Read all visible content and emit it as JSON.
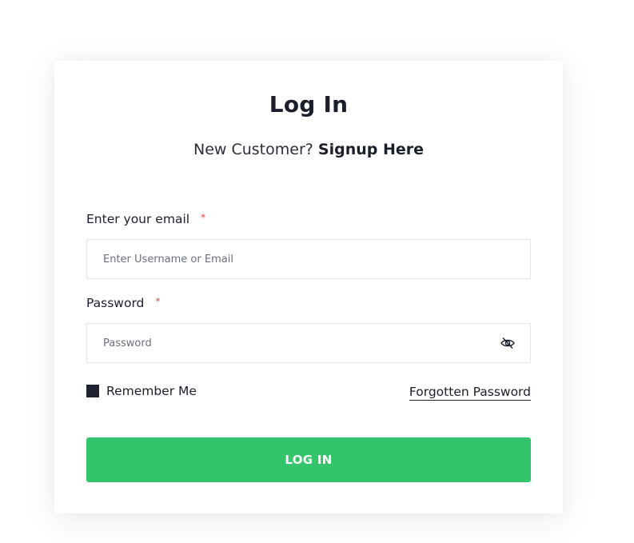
{
  "form": {
    "title": "Log In",
    "subtitle_prefix": "New Customer?",
    "signup_link": "Signup Here",
    "email_label": "Enter your email",
    "email_required": "*",
    "email_placeholder": "Enter Username or Email",
    "email_value": "",
    "password_label": "Password",
    "password_required": "*",
    "password_placeholder": "Password",
    "password_value": "",
    "password_toggle_icon": "eye-slash-icon",
    "remember_label": "Remember Me",
    "remember_checked": true,
    "forgot_link": "Forgotten Password",
    "submit_label": "LOG IN"
  },
  "colors": {
    "accent": "#33c46c",
    "text": "#1b1e2b",
    "required": "#e5484d",
    "checkbox": "#1f2330",
    "border": "#e6e7ea"
  }
}
